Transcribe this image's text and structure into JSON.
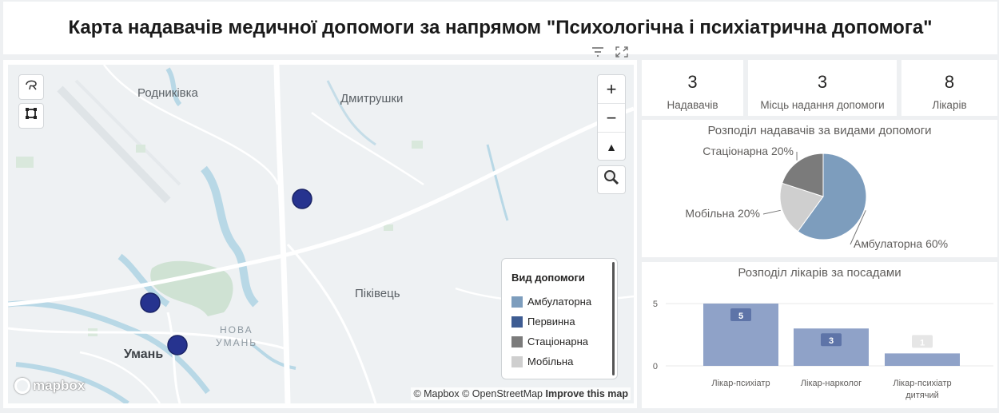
{
  "title": "Карта надавачів медичної допомоги за напрямом \"Психологічна і психіатрична допомога\"",
  "map": {
    "places": [
      {
        "name": "Родниківка"
      },
      {
        "name": "Дмитрушки"
      },
      {
        "name": "Піківець"
      },
      {
        "name": "Умань"
      },
      {
        "name": "НОВА"
      },
      {
        "name": "УМАНЬ"
      }
    ],
    "zoom_in": "+",
    "zoom_out": "−",
    "compass": "▲",
    "legend": {
      "title": "Вид допомоги",
      "items": [
        {
          "label": "Амбулаторна",
          "color": "#7d9dbd"
        },
        {
          "label": "Первинна",
          "color": "#3e5c92"
        },
        {
          "label": "Стаціонарна",
          "color": "#7b7b7b"
        },
        {
          "label": "Мобільна",
          "color": "#cfcfcf"
        }
      ]
    },
    "markers_color": "#26338f",
    "logo": "mapbox",
    "attribution_prefix": "© Mapbox © OpenStreetMap",
    "attribution_link": "Improve this map"
  },
  "cards": [
    {
      "value": "3",
      "label": "Надавачів"
    },
    {
      "value": "3",
      "label": "Місць надання допомоги"
    },
    {
      "value": "8",
      "label": "Лікарів"
    }
  ],
  "chart_data": [
    {
      "type": "pie",
      "title": "Розподіл надавачів за видами допомоги",
      "slices": [
        {
          "label": "Амбулаторна",
          "percent": 60,
          "display": "Амбулаторна 60%",
          "color": "#7d9dbd"
        },
        {
          "label": "Мобільна",
          "percent": 20,
          "display": "Мобільна 20%",
          "color": "#cfcfcf"
        },
        {
          "label": "Стаціонарна",
          "percent": 20,
          "display": "Стаціонарна 20%",
          "color": "#7b7b7b"
        }
      ]
    },
    {
      "type": "bar",
      "title": "Розподіл лікарів за посадами",
      "categories": [
        "Лікар-психіатр",
        "Лікар-нарколог",
        "Лікар-психіатр дитячий"
      ],
      "values": [
        5,
        3,
        1
      ],
      "yticks": [
        0,
        5
      ],
      "ylim": [
        0,
        5
      ],
      "color": "#8fa2c8"
    }
  ]
}
